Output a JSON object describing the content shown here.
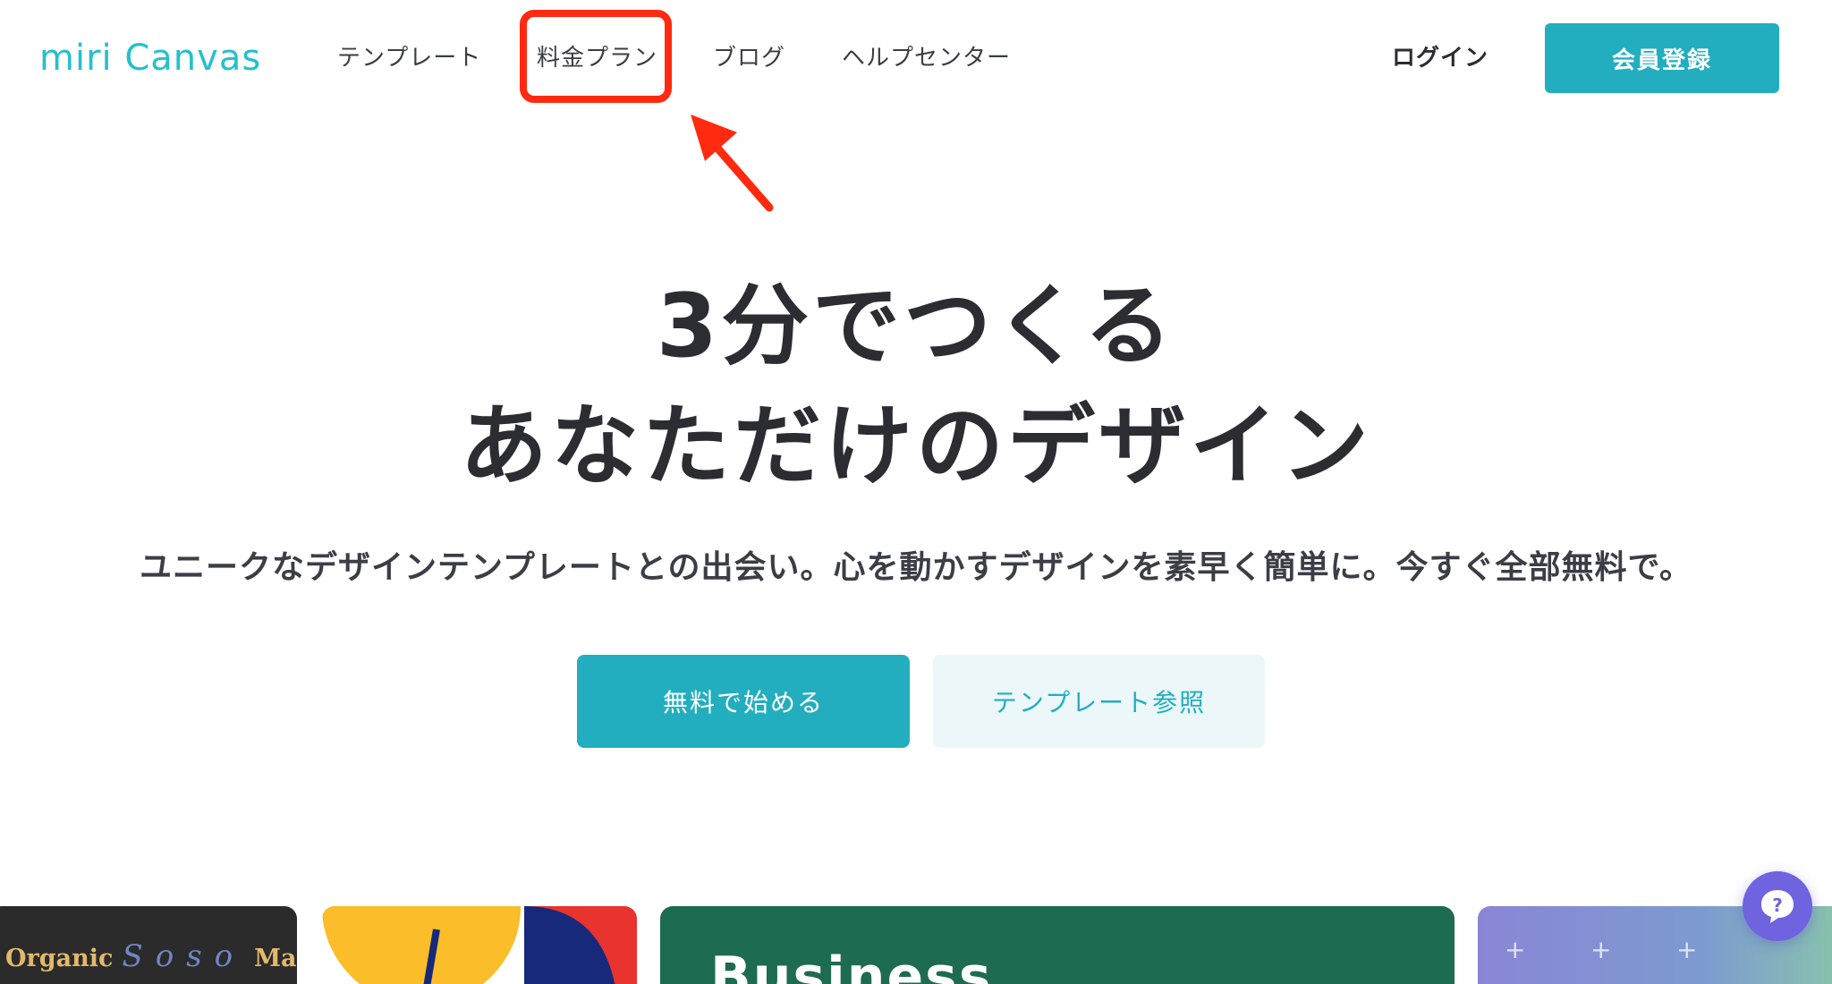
{
  "header": {
    "logo_text": "miri Canvas",
    "nav": [
      {
        "label": "テンプレート"
      },
      {
        "label": "料金プラン"
      },
      {
        "label": "ブログ"
      },
      {
        "label": "ヘルプセンター"
      }
    ],
    "login_label": "ログイン",
    "signup_label": "会員登録"
  },
  "hero": {
    "title_line1": "3分でつくる",
    "title_line2": "あなただけのデザイン",
    "subtitle": "ユニークなデザインテンプレートとの出会い。心を動かすデザインを素早く簡単に。今すぐ全部無料で。",
    "primary_button": "無料で始める",
    "secondary_button": "テンプレート参照"
  },
  "cards": {
    "card1_left": "Organic",
    "card1_script": "Soso",
    "card1_right": "Mart",
    "card3_text": "Business"
  },
  "colors": {
    "accent": "#23aebf",
    "highlight": "#ff2a10",
    "help_bubble": "#6f63e0"
  },
  "icons": {
    "help": "question-mark-chat-icon",
    "annotation": "red-arrow-icon"
  }
}
